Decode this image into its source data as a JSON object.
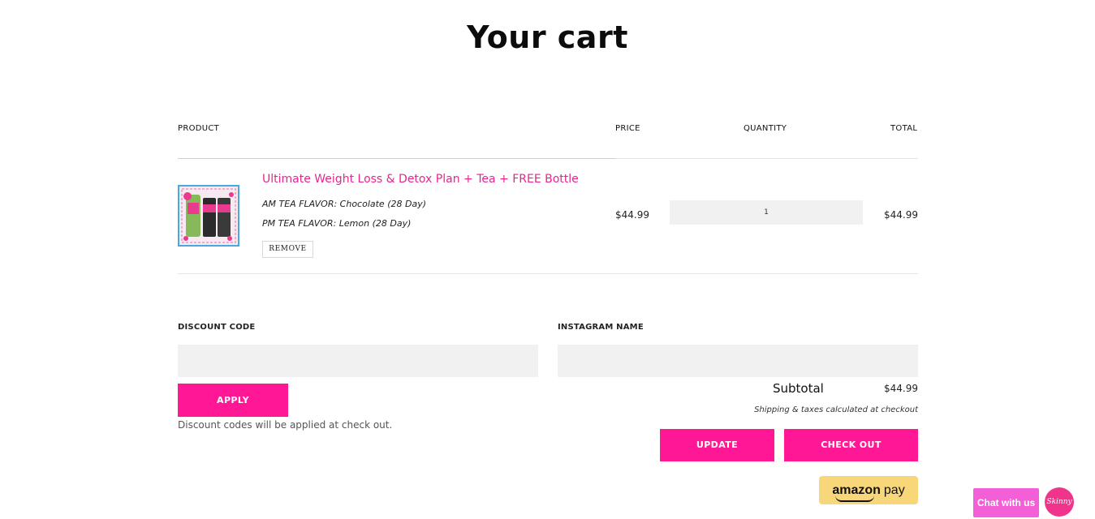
{
  "page": {
    "title": "Your cart"
  },
  "table": {
    "headers": {
      "product": "PRODUCT",
      "price": "PRICE",
      "quantity": "QUANTITY",
      "total": "TOTAL"
    },
    "items": [
      {
        "title": "Ultimate Weight Loss & Detox Plan + Tea + FREE Bottle",
        "variant_am": "AM TEA FLAVOR: Chocolate (28 Day)",
        "variant_pm": "PM TEA FLAVOR: Lemon (28 Day)",
        "remove_label": "REMOVE",
        "price": "$44.99",
        "quantity": "1",
        "total": "$44.99"
      }
    ]
  },
  "discount": {
    "label": "DISCOUNT CODE",
    "value": "",
    "apply_label": "APPLY",
    "hint": "Discount codes will be applied at check out."
  },
  "instagram": {
    "label": "INSTAGRAM NAME",
    "value": ""
  },
  "summary": {
    "subtotal_label": "Subtotal",
    "subtotal_value": "$44.99",
    "shipping_note": "Shipping & taxes calculated at checkout",
    "update_label": "UPDATE",
    "checkout_label": "CHECK OUT"
  },
  "amazon_pay": {
    "brand": "amazon",
    "label": "pay"
  },
  "chat": {
    "label": "Chat with us",
    "avatar_text": "Skinny"
  },
  "colors": {
    "accent": "#ff1796",
    "link": "#e5268f",
    "amazon": "#f8d77a",
    "chat": "#f25fd7"
  }
}
